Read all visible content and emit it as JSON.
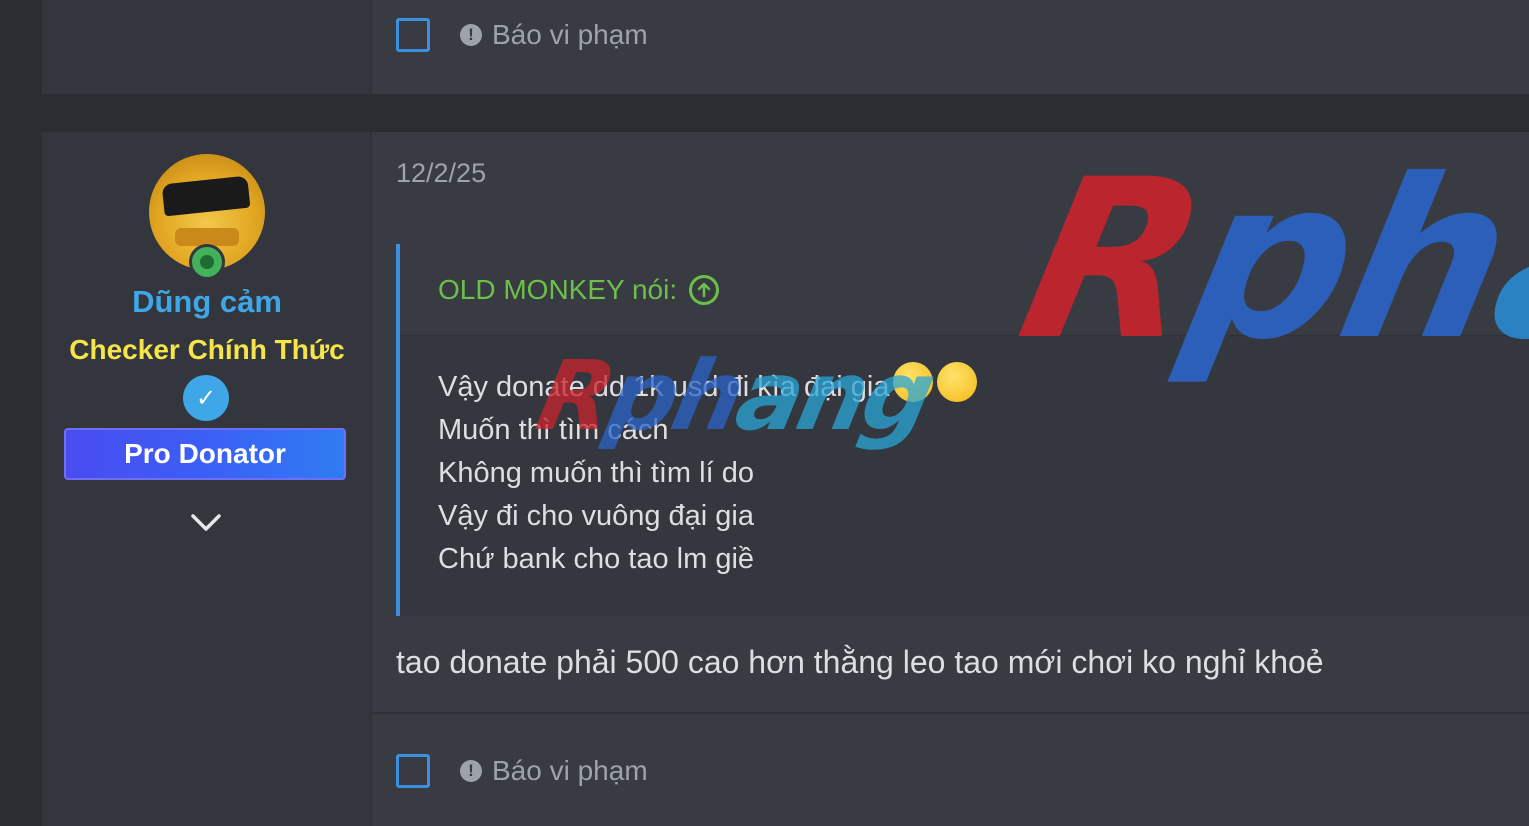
{
  "prev_post": {
    "report_label": "Báo vi phạm"
  },
  "post": {
    "user": {
      "username": "Dũng cảm",
      "title": "Checker Chính Thức",
      "banner": "Pro Donator"
    },
    "date": "12/2/25",
    "quote": {
      "author_line": "OLD MONKEY nói:",
      "lines": [
        "Vậy donate dd 1k usd đi kìa đại gia",
        "Muốn thì tìm cách",
        "Không muốn thì tìm lí do",
        "Vậy đi cho vuông đại gia",
        "Chứ bank cho tao lm giề"
      ]
    },
    "body": "tao donate phải 500 cao hơn thằng leo tao mới chơi ko nghỉ khoẻ",
    "report_label": "Báo vi phạm"
  },
  "watermark": {
    "big_red": "R",
    "big_blue": "ph",
    "big_teal": "a",
    "small_red": "R",
    "small_blue": "ph",
    "small_teal": "ang"
  },
  "colors": {
    "background": "#2a2d32",
    "panel": "#383b41",
    "accent_blue": "#3d8fe0",
    "username_blue": "#3fa6e8",
    "title_yellow": "#f6e44b",
    "quote_green": "#6cc04a",
    "online_green": "#43b05c"
  },
  "icons": {
    "report": "exclamation-circle-icon",
    "quote_jump": "arrow-up-circle-icon",
    "expand": "chevron-down-icon",
    "verify": "verified-user-icon",
    "online": "online-status-icon"
  }
}
